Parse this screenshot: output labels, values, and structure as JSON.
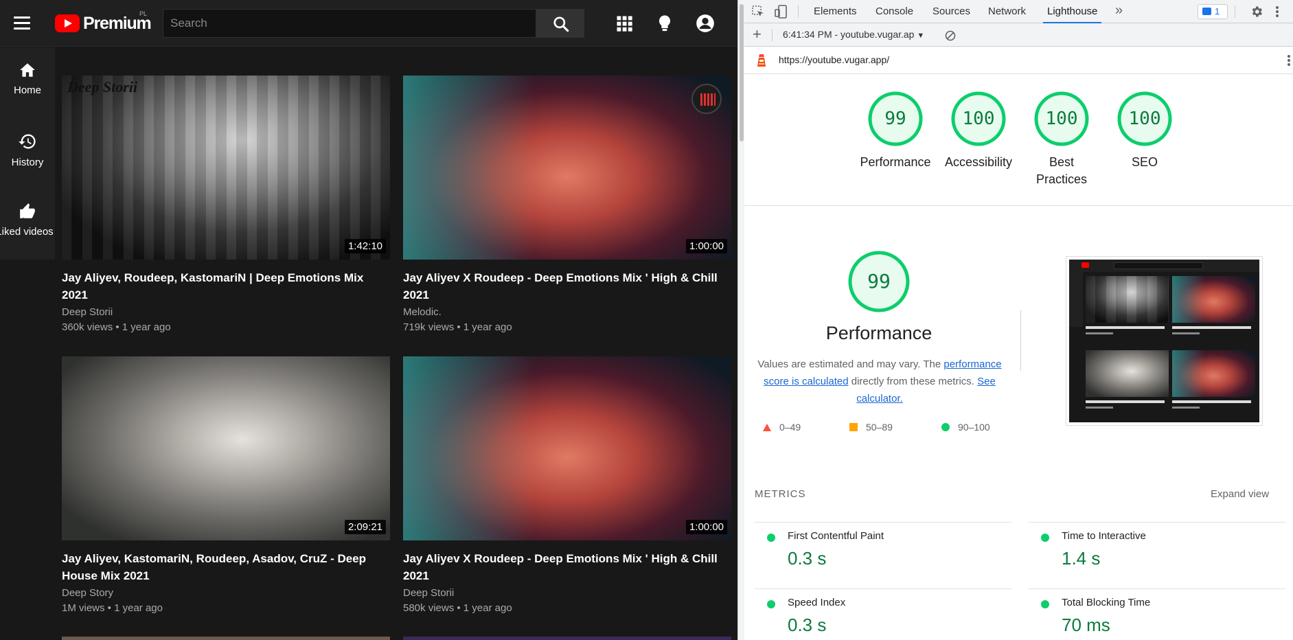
{
  "youtube": {
    "logo_text": "Premium",
    "region": "PL",
    "search_placeholder": "Search",
    "sidebar": [
      {
        "label": "Home",
        "icon": "home-icon"
      },
      {
        "label": "History",
        "icon": "history-icon"
      },
      {
        "label": "Liked videos",
        "icon": "thumbs-up-icon"
      }
    ],
    "videos": [
      {
        "title": "Jay Aliyev, Roudeep, KastomariN | Deep Emotions Mix 2021",
        "channel": "Deep Storii",
        "meta": "360k views • 1 year ago",
        "duration": "1:42:10",
        "watermark": "Deep Storii"
      },
      {
        "title": "Jay Aliyev X Roudeep - Deep Emotions Mix ' High & Chill 2021",
        "channel": "Melodic.",
        "meta": "719k views • 1 year ago",
        "duration": "1:00:00"
      },
      {
        "title": "Jay Aliyev, KastomariN, Roudeep, Asadov, CruZ - Deep House Mix 2021",
        "channel": "Deep Story",
        "meta": "1M views • 1 year ago",
        "duration": "2:09:21"
      },
      {
        "title": "Jay Aliyev X Roudeep - Deep Emotions Mix ' High & Chill 2021",
        "channel": "Deep Storii",
        "meta": "580k views • 1 year ago",
        "duration": "1:00:00"
      }
    ]
  },
  "devtools": {
    "tabs": [
      "Elements",
      "Console",
      "Sources",
      "Network",
      "Lighthouse"
    ],
    "active_tab": "Lighthouse",
    "issues_count": "1",
    "report_selector": "6:41:34 PM - youtube.vugar.ap",
    "url": "https://youtube.vugar.app/",
    "scores": [
      {
        "value": 99,
        "label": "Performance"
      },
      {
        "value": 100,
        "label": "Accessibility"
      },
      {
        "value": 100,
        "label": "Best Practices"
      },
      {
        "value": 100,
        "label": "SEO"
      }
    ],
    "performance": {
      "score": 99,
      "title": "Performance",
      "desc_prefix": "Values are estimated and may vary. The ",
      "desc_link1": "performance score is calculated",
      "desc_middle": " directly from these metrics. ",
      "desc_link2": "See calculator."
    },
    "legend": [
      {
        "range": "0–49",
        "color": "#ff4e42",
        "shape": "triangle"
      },
      {
        "range": "50–89",
        "color": "#ffa400",
        "shape": "square"
      },
      {
        "range": "90–100",
        "color": "#0cce6b",
        "shape": "circle"
      }
    ],
    "metrics_label": "METRICS",
    "expand_label": "Expand view",
    "metrics": [
      {
        "name": "First Contentful Paint",
        "value": "0.3 s"
      },
      {
        "name": "Time to Interactive",
        "value": "1.4 s"
      },
      {
        "name": "Speed Index",
        "value": "0.3 s"
      },
      {
        "name": "Total Blocking Time",
        "value": "70 ms"
      }
    ],
    "colors": {
      "pass": "#0cce6b",
      "pass_text": "#0c7a3d",
      "accent": "#1a73e8"
    }
  }
}
